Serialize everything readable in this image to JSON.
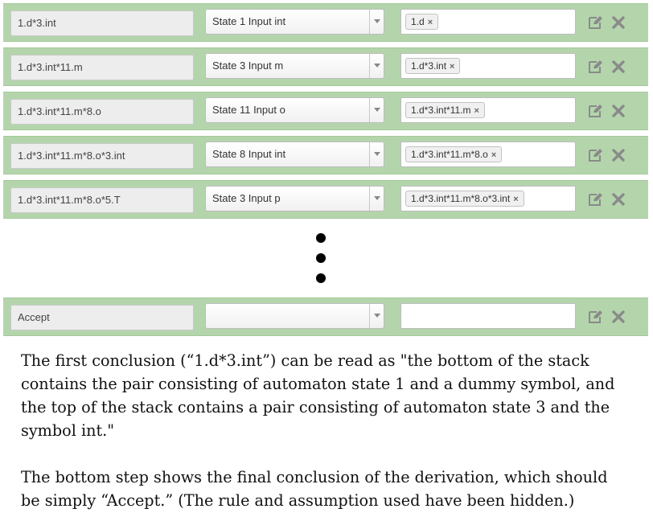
{
  "rows": [
    {
      "conclusion": "1.d*3.int",
      "rule": "State 1 Input int",
      "assumption": "1.d"
    },
    {
      "conclusion": "1.d*3.int*11.m",
      "rule": "State 3 Input m",
      "assumption": "1.d*3.int"
    },
    {
      "conclusion": "1.d*3.int*11.m*8.o",
      "rule": "State 11 Input o",
      "assumption": "1.d*3.int*11.m"
    },
    {
      "conclusion": "1.d*3.int*11.m*8.o*3.int",
      "rule": "State 8 Input int",
      "assumption": "1.d*3.int*11.m*8.o"
    },
    {
      "conclusion": "1.d*3.int*11.m*8.o*5.T",
      "rule": "State 3 Input p",
      "assumption": "1.d*3.int*11.m*8.o*3.int"
    }
  ],
  "final_row": {
    "conclusion": "Accept",
    "rule": "",
    "assumption": ""
  },
  "tag_remove_glyph": "×",
  "icons": {
    "edit": "edit-icon",
    "delete": "close-icon",
    "dropdown": "chevron-down-icon"
  },
  "colors": {
    "row_bg": "#b4d5ac",
    "icon": "#8a8a8a"
  },
  "caption": {
    "paragraph1_lines": [
      "The first conclusion (“1.d*3.int”) can be read as \"the bottom of the stack",
      "contains the pair consisting of automaton state 1 and a dummy symbol, and",
      "the top of the stack contains a pair consisting of automaton state 3 and the",
      "symbol int.\""
    ],
    "paragraph2_lines": [
      "The bottom step shows the final conclusion of the derivation, which should",
      "be simply “Accept.” (The rule and assumption used have been hidden.)"
    ]
  }
}
